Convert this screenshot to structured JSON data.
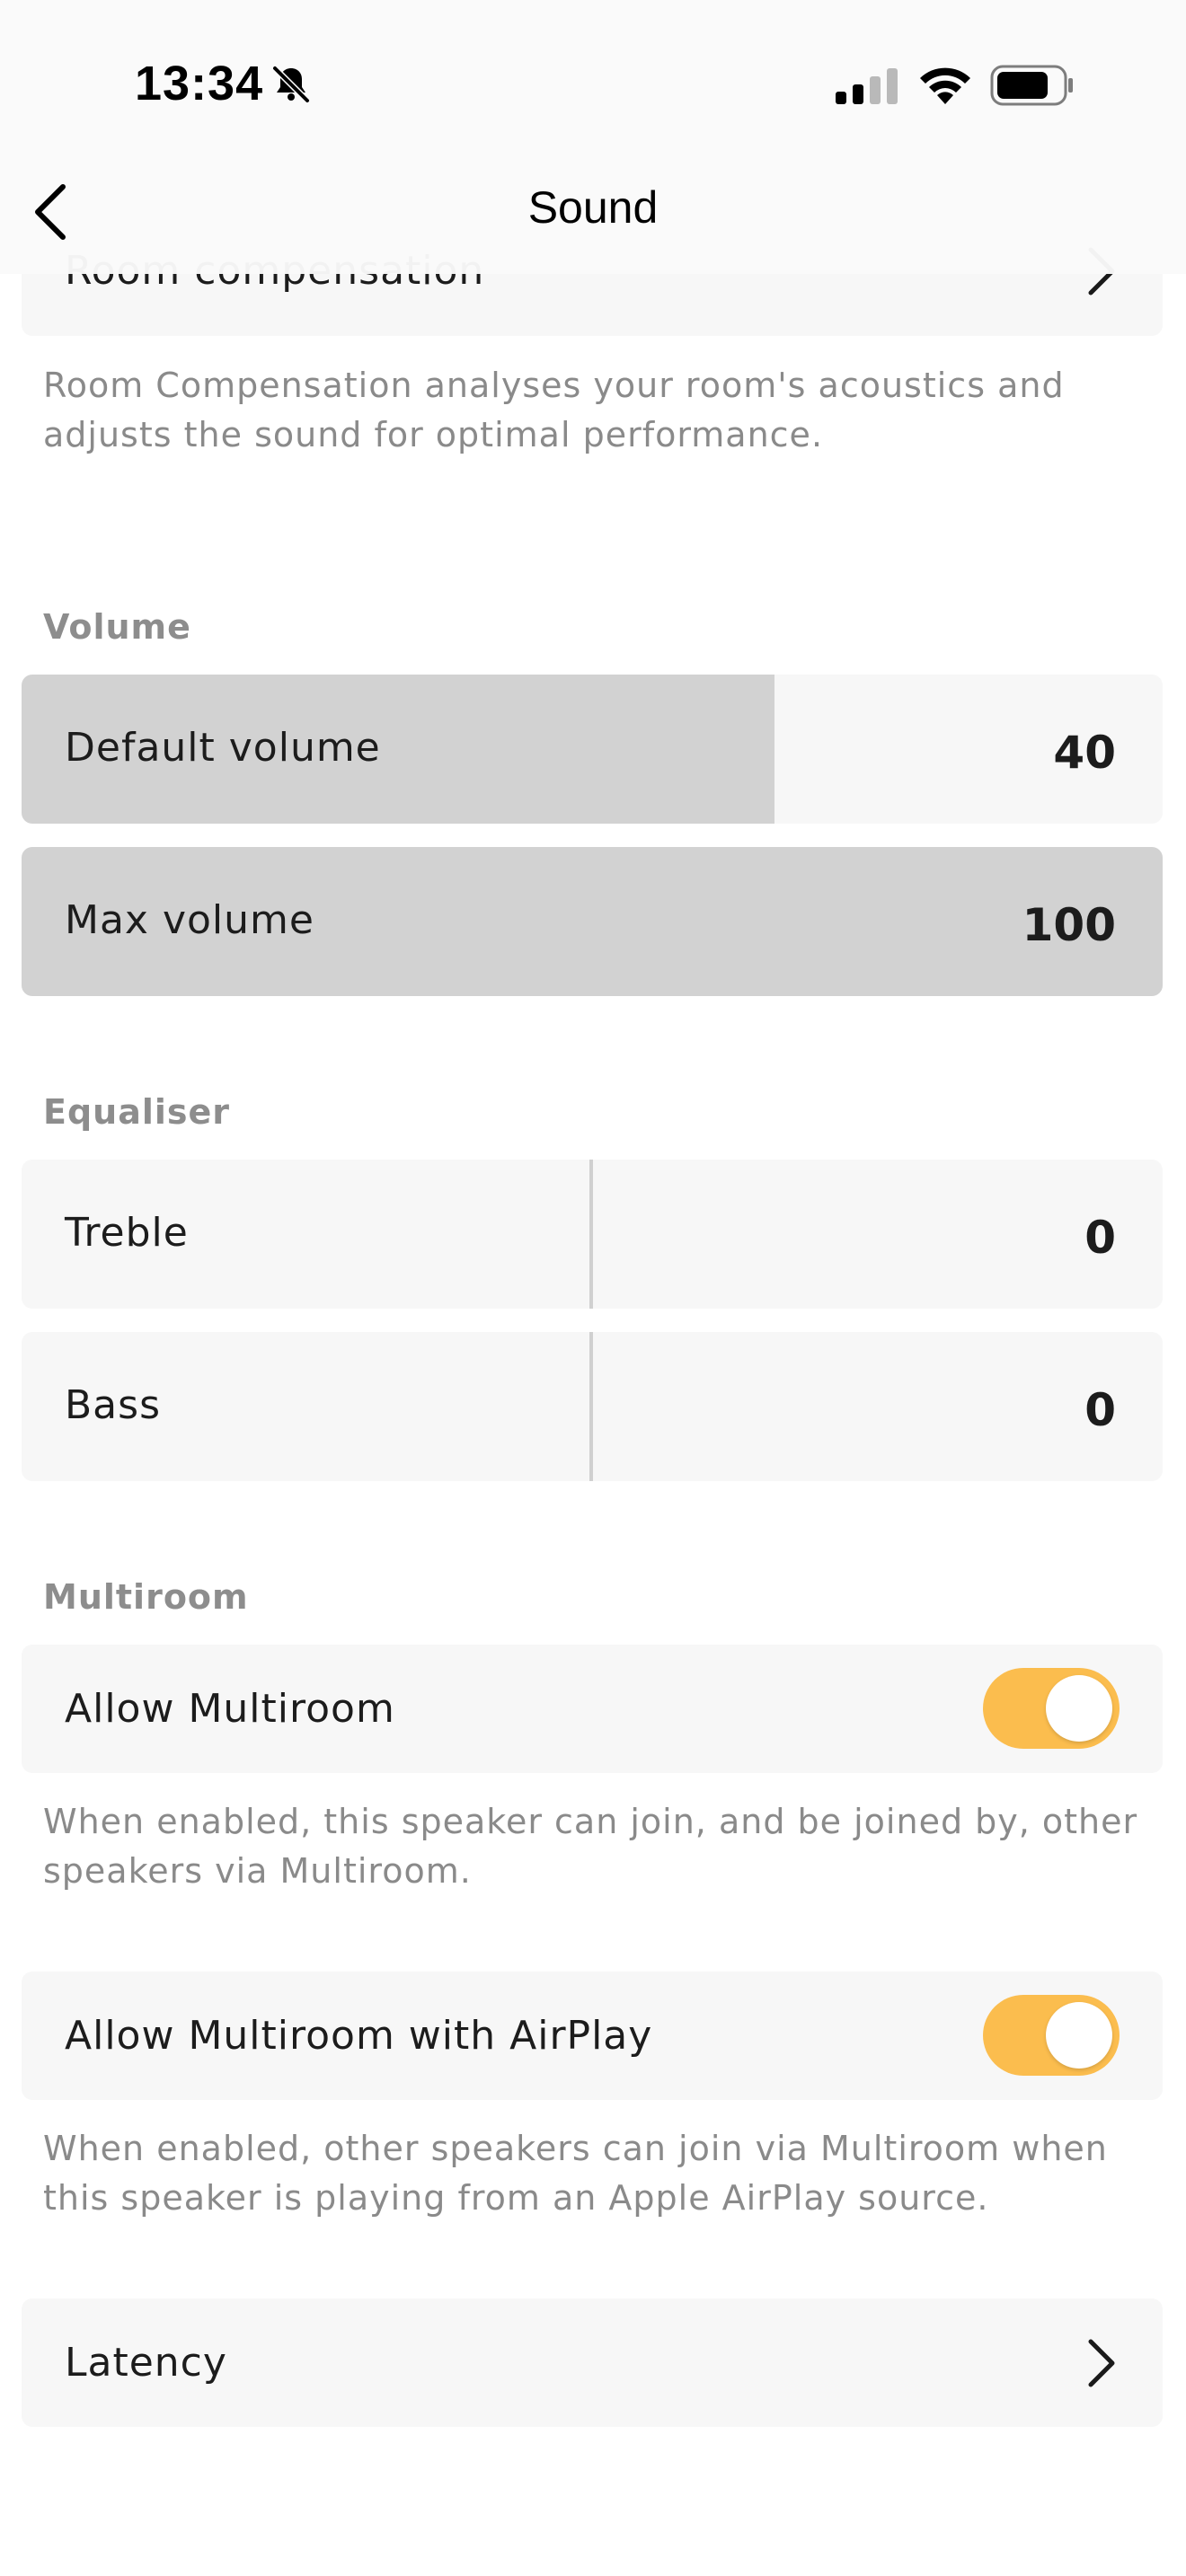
{
  "status_bar": {
    "time": "13:34"
  },
  "nav": {
    "title": "Sound"
  },
  "room_compensation": {
    "label": "Room compensation",
    "help": "Room Compensation analyses your room's acoustics and adjusts the sound for optimal performance."
  },
  "volume": {
    "section_title": "Volume",
    "default_label": "Default volume",
    "default_value": "40",
    "default_level": 0.66,
    "max_label": "Max volume",
    "max_value": "100",
    "max_level": 1.0
  },
  "equaliser": {
    "section_title": "Equaliser",
    "treble_label": "Treble",
    "treble_value": "0",
    "bass_label": "Bass",
    "bass_value": "0"
  },
  "multiroom": {
    "section_title": "Multiroom",
    "allow_label": "Allow Multiroom",
    "allow_enabled": true,
    "allow_help": "When enabled, this speaker can join, and be joined by, other speakers via Multiroom.",
    "airplay_label": "Allow Multiroom with AirPlay",
    "airplay_enabled": true,
    "airplay_help": "When enabled, other speakers can join via Multiroom when this speaker is playing from an Apple AirPlay source."
  },
  "latency": {
    "label": "Latency"
  },
  "colors": {
    "toggle_on": "#fbbd4e",
    "fill": "#d2d2d2",
    "card": "#f7f7f7",
    "help_text": "#8a8a8a"
  }
}
